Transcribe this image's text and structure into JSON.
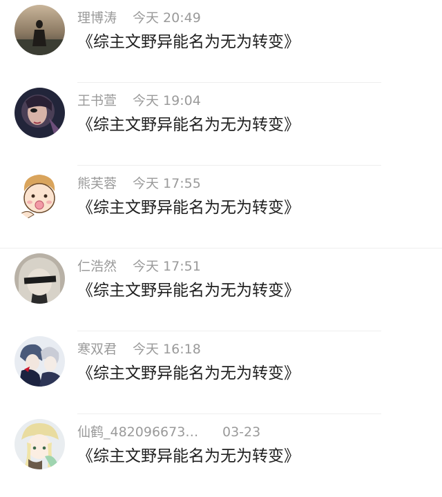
{
  "messages": [
    {
      "avatar_icon": "silhouette-photo-icon",
      "name": "理博涛",
      "time": "今天 20:49",
      "text": "《综主文野异能名为无为转变》"
    },
    {
      "avatar_icon": "masked-woman-icon",
      "name": "王书萱",
      "time": "今天 19:04",
      "text": "《综主文野异能名为无为转变》"
    },
    {
      "avatar_icon": "cartoon-baby-icon",
      "name": "熊芙蓉",
      "time": "今天 17:55",
      "text": "《综主文野异能名为无为转变》"
    },
    {
      "avatar_icon": "blindfold-android-icon",
      "name": "仁浩然",
      "time": "今天 17:51",
      "text": "《综主文野异能名为无为转变》"
    },
    {
      "avatar_icon": "anime-couple-icon",
      "name": "寒双君",
      "time": "今天 16:18",
      "text": "《综主文野异能名为无为转变》"
    },
    {
      "avatar_icon": "anime-girl-hat-icon",
      "name": "仙鹤_482096673…",
      "time": "03-23",
      "text": "《综主文野异能名为无为转变》"
    }
  ]
}
